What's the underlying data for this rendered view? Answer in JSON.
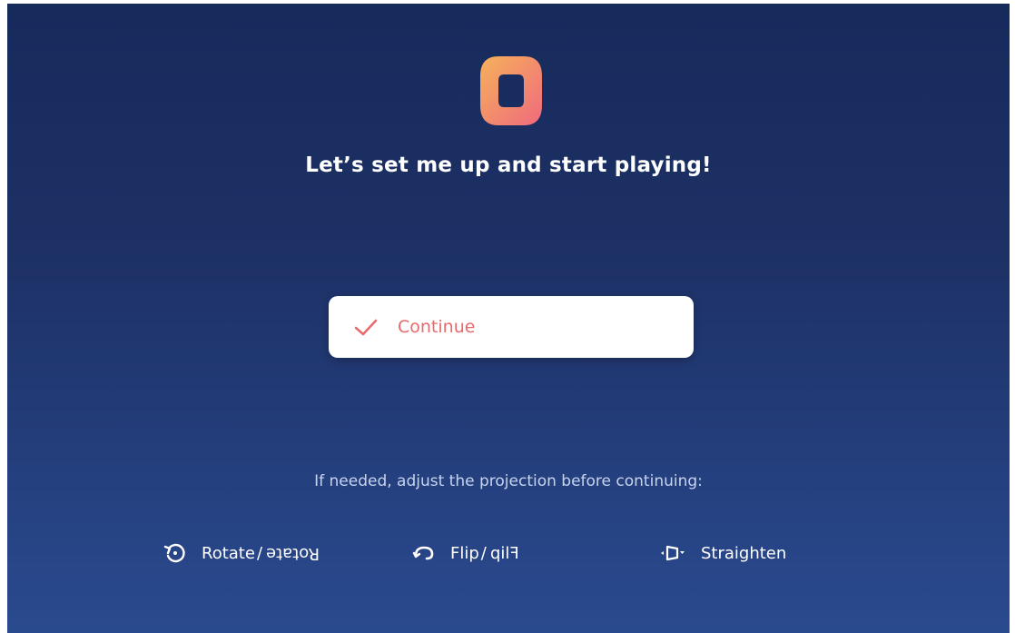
{
  "app": {
    "logo_icon": "osmo-logo-icon",
    "headline": "Let’s set me up and start playing!"
  },
  "continue_button": {
    "label": "Continue",
    "icon": "check-icon",
    "label_color": "#e86a6a"
  },
  "adjust": {
    "hint": "If needed, adjust the projection before continuing:",
    "tools": [
      {
        "icon": "rotate-icon",
        "label": "Rotate",
        "mirrored_label": "Rotate",
        "separator": "/"
      },
      {
        "icon": "flip-icon",
        "label": "Flip",
        "mirrored_label": "Flip",
        "separator": "/"
      },
      {
        "icon": "straighten-icon",
        "label": "Straighten"
      }
    ]
  },
  "colors": {
    "background_top": "#172a5c",
    "background_bottom": "#2a4a8f",
    "logo_gradient_start": "#f6b15b",
    "logo_gradient_end": "#ef6a7d"
  }
}
